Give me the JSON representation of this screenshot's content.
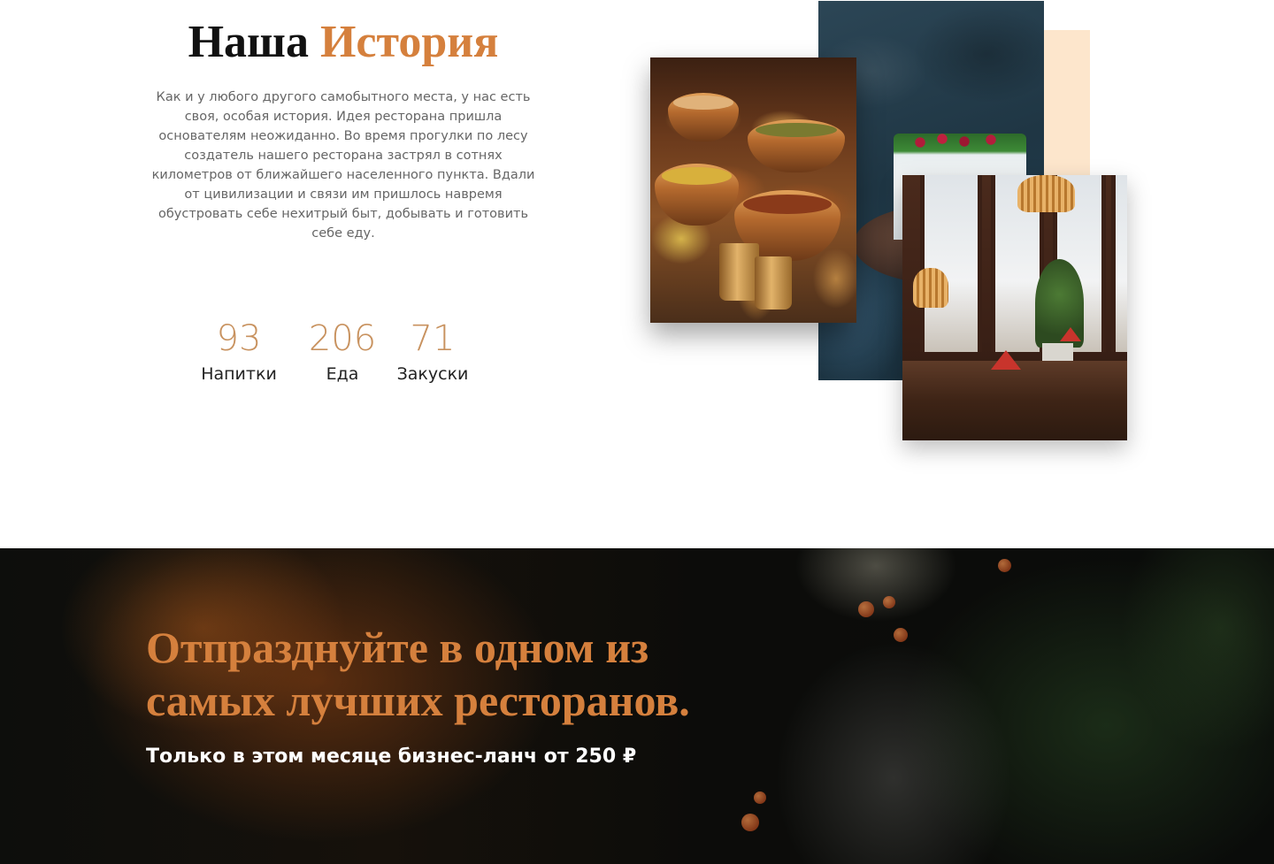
{
  "history": {
    "title_part1": "Наша",
    "title_part2": "История",
    "text": "Как и у любого другого самобытного места, у нас есть своя, особая история. Идея ресторана пришла основателям неожиданно. Во время прогулки по лесу создатель нашего ресторана застрял в сотнях километров от ближайшего населенного пункта. Вдали от цивилизации и связи им пришлось наврeмя обустровать себе нехитрый быт, добывать и готовить себе еду.",
    "stats": [
      {
        "value": "93",
        "label": "Напитки"
      },
      {
        "value": "206",
        "label": "Еда"
      },
      {
        "value": "71",
        "label": "Закуски"
      }
    ]
  },
  "promo": {
    "title_line1": "Отпразднуйте в одном из",
    "title_line2": "самых лучших ресторанов.",
    "subtitle": "Только в этом месяце бизнес-ланч от 250 ₽"
  },
  "colors": {
    "accent": "#d5803d",
    "stat_number": "#c8925f",
    "peach_block": "#fde6cc"
  }
}
